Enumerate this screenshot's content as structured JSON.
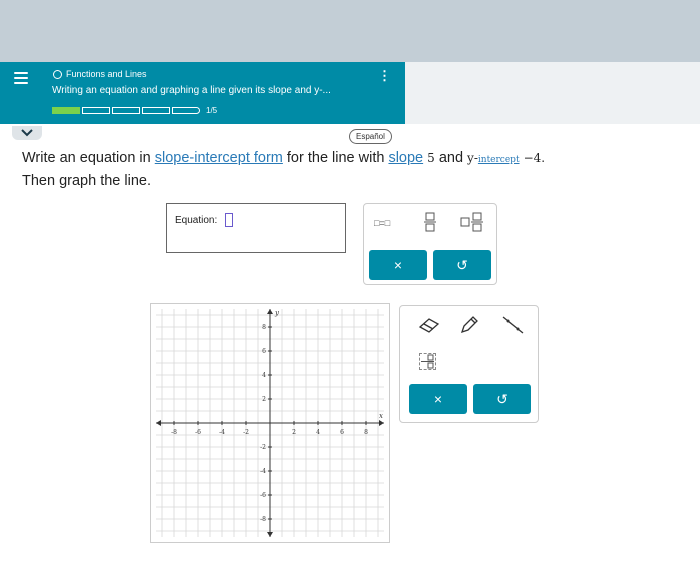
{
  "header": {
    "topic": "Functions and Lines",
    "subtitle": "Writing an equation and graphing a line given its slope and y-...",
    "progress": {
      "completed": 1,
      "total": 5,
      "text": "1/5"
    }
  },
  "language_button": "Español",
  "question": {
    "part1": "Write an equation in ",
    "link1": "slope-intercept form",
    "part2": " for the line with ",
    "link2": "slope",
    "slope_value": "5",
    "part3": " and ",
    "y_prefix": "y-",
    "link3": "intercept",
    "intercept_value": "−4.",
    "line2": "Then graph the line."
  },
  "equation": {
    "label": "Equation:"
  },
  "equation_tools": {
    "equals_template": "□=□",
    "undo_glyph": "↺",
    "clear_glyph": "×"
  },
  "graph": {
    "x_axis_label": "x",
    "y_axis_label": "y",
    "x_ticks": [
      "-8",
      "-6",
      "-4",
      "-2",
      "2",
      "4",
      "6",
      "8"
    ],
    "y_ticks": [
      "8",
      "6",
      "4",
      "2",
      "-2",
      "-4",
      "-6",
      "-8"
    ]
  },
  "graph_tools": {
    "clear_glyph": "×",
    "undo_glyph": "↺"
  },
  "colors": {
    "header": "#008ba6",
    "progress": "#7cd14c",
    "button": "#008ba6",
    "link": "#2a7ab7"
  }
}
